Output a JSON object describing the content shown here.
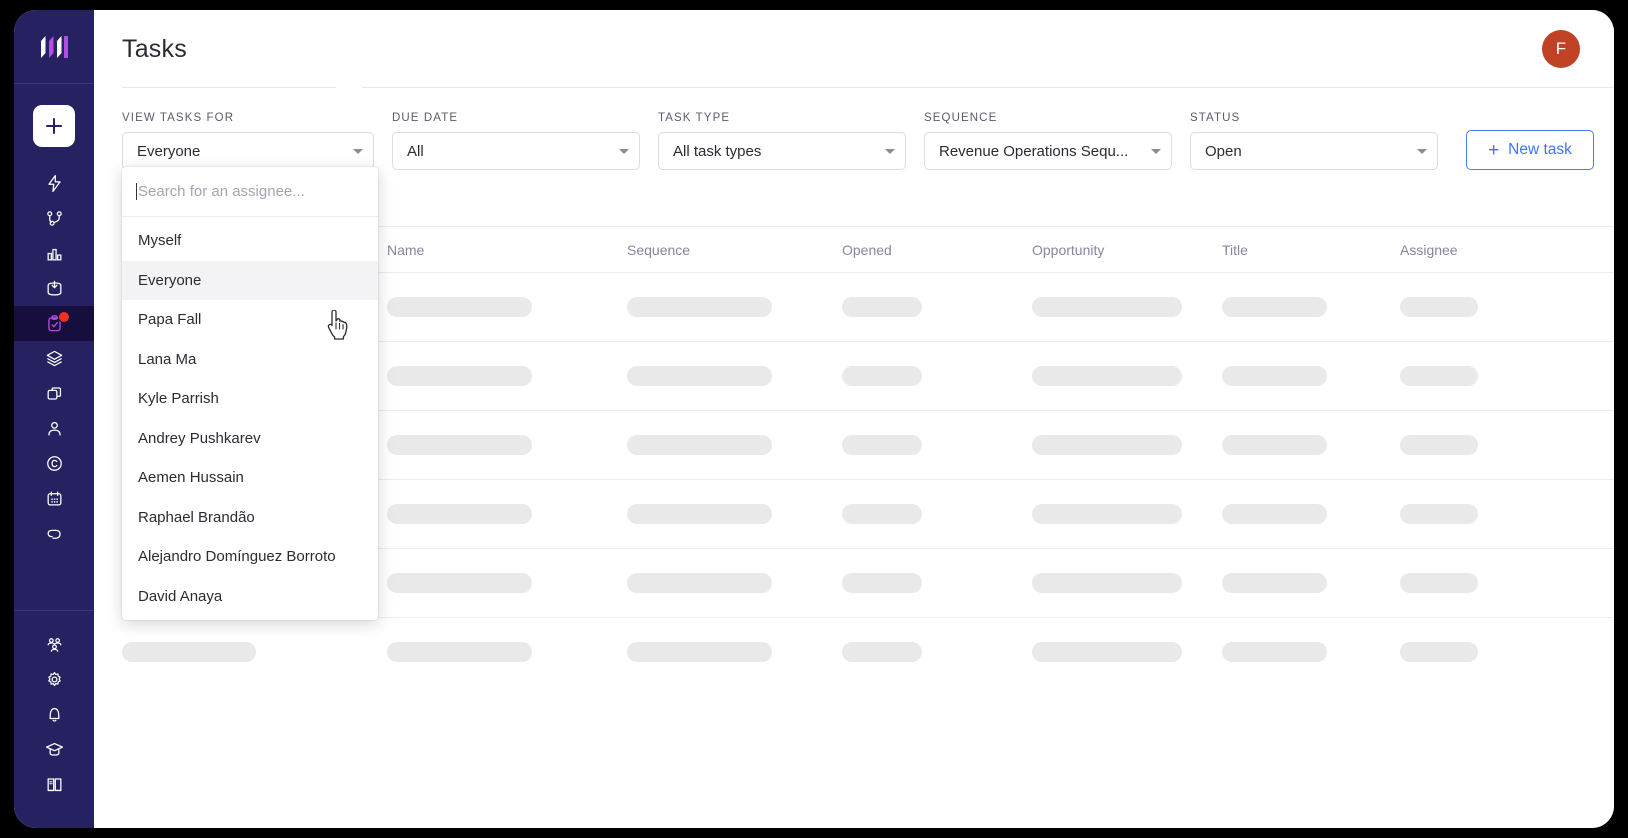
{
  "app": {
    "logo_name": "outreach-logo",
    "avatar_initial": "F",
    "avatar_color": "#bf4224",
    "accent_color": "#3d76ef",
    "sidebar_color": "#262261",
    "badge_color": "#ef3124"
  },
  "header": {
    "title": "Tasks"
  },
  "sidebar": {
    "add_button": "add-button",
    "items": [
      {
        "name": "sidebar-item-automation",
        "icon": "lightning-bolt-icon",
        "active": false,
        "badge": false
      },
      {
        "name": "sidebar-item-sequences",
        "icon": "workflow-branch-icon",
        "active": false,
        "badge": false
      },
      {
        "name": "sidebar-item-reports",
        "icon": "bar-chart-icon",
        "active": false,
        "badge": false
      },
      {
        "name": "sidebar-item-inbox",
        "icon": "inbox-icon",
        "active": false,
        "badge": false
      },
      {
        "name": "sidebar-item-tasks",
        "icon": "clipboard-check-icon",
        "active": true,
        "badge": true
      },
      {
        "name": "sidebar-item-stack",
        "icon": "layers-icon",
        "active": false,
        "badge": false
      },
      {
        "name": "sidebar-item-duplicate",
        "icon": "copy-icon",
        "active": false,
        "badge": false
      },
      {
        "name": "sidebar-item-prospects",
        "icon": "person-icon",
        "active": false,
        "badge": false
      },
      {
        "name": "sidebar-item-accounts",
        "icon": "circle-c-icon",
        "active": false,
        "badge": false
      },
      {
        "name": "sidebar-item-calendar",
        "icon": "calendar-icon",
        "active": false,
        "badge": false
      },
      {
        "name": "sidebar-item-links",
        "icon": "link-icon",
        "active": false,
        "badge": false
      }
    ],
    "bottom_items": [
      {
        "name": "sidebar-item-team",
        "icon": "people-group-icon"
      },
      {
        "name": "sidebar-item-settings",
        "icon": "gear-icon"
      },
      {
        "name": "sidebar-item-notifications",
        "icon": "bell-icon"
      },
      {
        "name": "sidebar-item-academy",
        "icon": "graduation-cap-icon"
      },
      {
        "name": "sidebar-item-docs",
        "icon": "book-icon"
      }
    ]
  },
  "filters": [
    {
      "label": "VIEW TASKS FOR",
      "value": "Everyone",
      "name": "filter-view-tasks-for"
    },
    {
      "label": "DUE DATE",
      "value": "All",
      "name": "filter-due-date"
    },
    {
      "label": "TASK TYPE",
      "value": "All task types",
      "name": "filter-task-type"
    },
    {
      "label": "SEQUENCE",
      "value": "Revenue Operations Sequ...",
      "name": "filter-sequence"
    },
    {
      "label": "STATUS",
      "value": "Open",
      "name": "filter-status"
    }
  ],
  "new_task_button": {
    "label": "New task",
    "plus": "+"
  },
  "assignee_dropdown": {
    "search_placeholder": "Search for an assignee...",
    "search_value": "",
    "selected": "Everyone",
    "options": [
      "Myself",
      "Everyone",
      "Papa Fall",
      "Lana Ma",
      "Kyle Parrish",
      "Andrey Pushkarev",
      "Aemen Hussain",
      "Raphael Brandão",
      "Alejandro Domínguez Borroto",
      "David Anaya"
    ]
  },
  "table": {
    "columns": [
      "",
      "Name",
      "Sequence",
      "Opened",
      "Opportunity",
      "Title",
      "Assignee"
    ],
    "row_count": 6,
    "loading": true
  }
}
